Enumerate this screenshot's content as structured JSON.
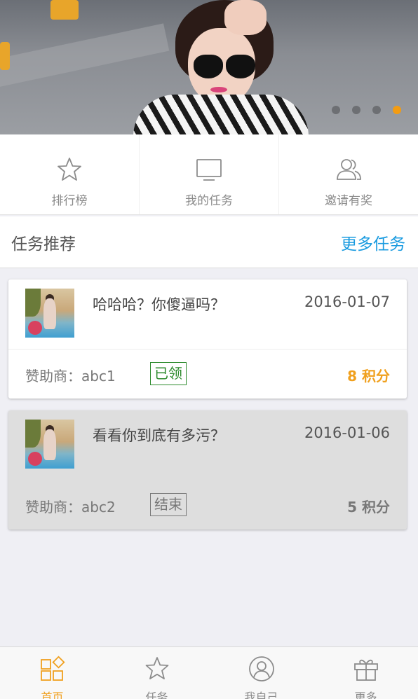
{
  "banner": {
    "slide_count": 4,
    "active_slide": 4
  },
  "quick_nav": [
    {
      "label": "排行榜",
      "icon": "star-icon"
    },
    {
      "label": "我的任务",
      "icon": "monitor-icon"
    },
    {
      "label": "邀请有奖",
      "icon": "users-icon"
    }
  ],
  "section": {
    "title": "任务推荐",
    "more_label": "更多任务"
  },
  "tasks": [
    {
      "title": "哈哈哈？你傻逼吗？",
      "date": "2016-01-07",
      "sponsor": "赞助商：abc1",
      "status": "已领",
      "points": "8 积分"
    },
    {
      "title": "看看你到底有多污？",
      "date": "2016-01-06",
      "sponsor": "赞助商：abc2",
      "status": "结束",
      "points": "5 积分"
    }
  ],
  "tabbar": [
    {
      "label": "首页",
      "icon": "home-grid-icon",
      "active": true
    },
    {
      "label": "任务",
      "icon": "star-icon",
      "active": false
    },
    {
      "label": "我自己",
      "icon": "user-circle-icon",
      "active": false
    },
    {
      "label": "更多",
      "icon": "gift-icon",
      "active": false
    }
  ],
  "colors": {
    "accent": "#f0a01e",
    "link": "#1a9be0",
    "taken_green": "#2b8a2b"
  }
}
